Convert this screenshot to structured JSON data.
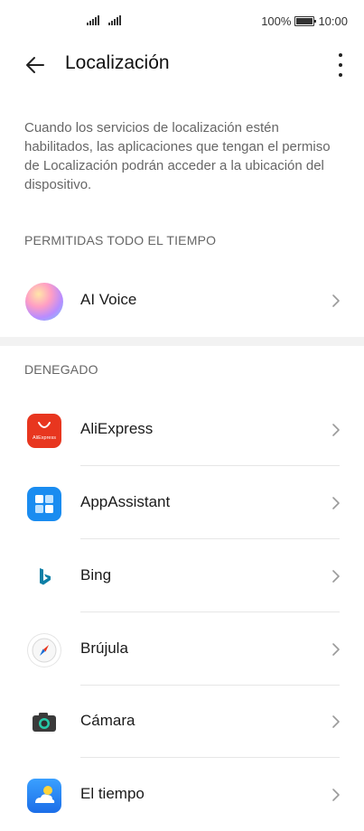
{
  "status": {
    "battery": "100%",
    "time": "10:00"
  },
  "header": {
    "title": "Localización"
  },
  "description": "Cuando los servicios de localización estén habilitados, las aplicaciones que tengan el permiso de Localización podrán acceder a la ubicación del dispositivo.",
  "sections": {
    "allowed": {
      "title": "PERMITIDAS TODO EL TIEMPO",
      "items": [
        {
          "label": "AI Voice",
          "icon": "ai-voice-icon"
        }
      ]
    },
    "denied": {
      "title": "DENEGADO",
      "items": [
        {
          "label": "AliExpress",
          "icon": "aliexpress-icon"
        },
        {
          "label": "AppAssistant",
          "icon": "appassistant-icon"
        },
        {
          "label": "Bing",
          "icon": "bing-icon"
        },
        {
          "label": "Brújula",
          "icon": "compass-icon"
        },
        {
          "label": "Cámara",
          "icon": "camera-icon"
        },
        {
          "label": "El tiempo",
          "icon": "weather-icon"
        }
      ]
    }
  },
  "colors": {
    "aliexpress": "#e8361f",
    "appassistant": "#1a8cf0",
    "bing": "#0c7fa6"
  },
  "aliexpress_logo_text": "AliExpress"
}
